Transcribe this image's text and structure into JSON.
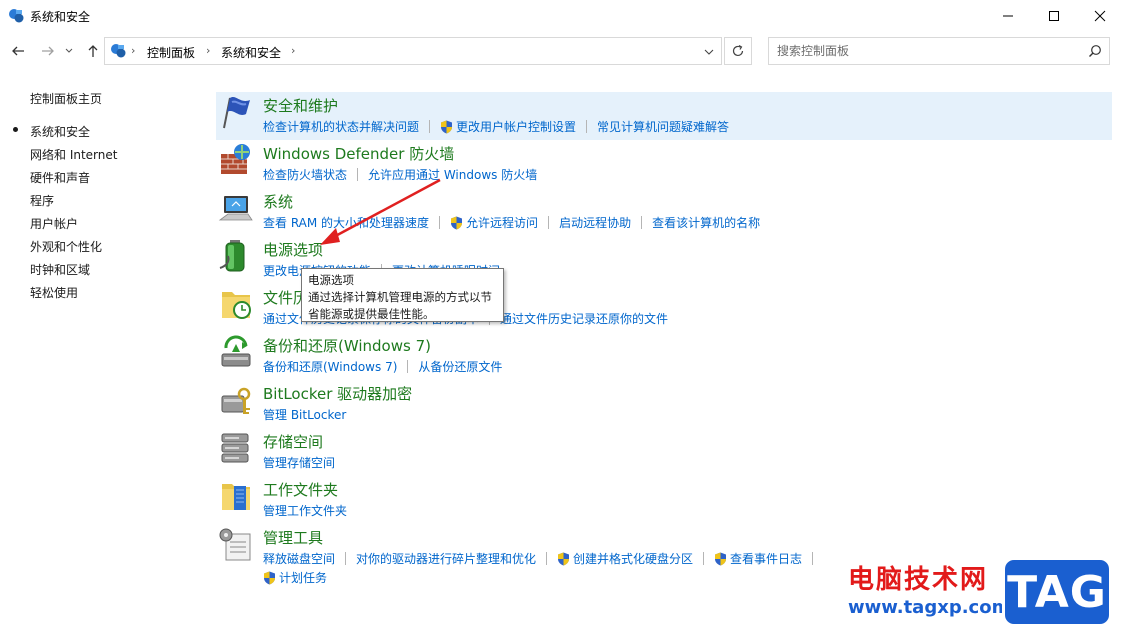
{
  "window": {
    "title": "系统和安全"
  },
  "address": {
    "crumbs": [
      "控制面板",
      "系统和安全"
    ]
  },
  "search": {
    "placeholder": "搜索控制面板"
  },
  "sidebar": {
    "items": [
      {
        "label": "控制面板主页",
        "selected": false
      },
      {
        "label": "系统和安全",
        "selected": true
      },
      {
        "label": "网络和 Internet",
        "selected": false
      },
      {
        "label": "硬件和声音",
        "selected": false
      },
      {
        "label": "程序",
        "selected": false
      },
      {
        "label": "用户帐户",
        "selected": false
      },
      {
        "label": "外观和个性化",
        "selected": false
      },
      {
        "label": "时钟和区域",
        "selected": false
      },
      {
        "label": "轻松使用",
        "selected": false
      }
    ]
  },
  "categories": [
    {
      "title": "安全和维护",
      "icon": "flag-icon",
      "links": [
        {
          "label": "检查计算机的状态并解决问题",
          "shield": false
        },
        {
          "label": "更改用户帐户控制设置",
          "shield": true
        },
        {
          "label": "常见计算机问题疑难解答",
          "shield": false
        }
      ]
    },
    {
      "title": "Windows Defender 防火墙",
      "icon": "firewall-icon",
      "links": [
        {
          "label": "检查防火墙状态",
          "shield": false
        },
        {
          "label": "允许应用通过 Windows 防火墙",
          "shield": false
        }
      ]
    },
    {
      "title": "系统",
      "icon": "computer-icon",
      "links": [
        {
          "label": "查看 RAM 的大小和处理器速度",
          "shield": false
        },
        {
          "label": "允许远程访问",
          "shield": true
        },
        {
          "label": "启动远程协助",
          "shield": false
        },
        {
          "label": "查看该计算机的名称",
          "shield": false
        }
      ]
    },
    {
      "title": "电源选项",
      "icon": "battery-icon",
      "links": [
        {
          "label": "更改电源按钮的功能",
          "shield": false
        },
        {
          "label": "更改计算机睡眠时间",
          "shield": false
        }
      ]
    },
    {
      "title": "文件历史记录",
      "icon": "file-history-icon",
      "links": [
        {
          "label": "通过文件历史记录保存你的文件备份副本",
          "shield": false
        },
        {
          "label": "通过文件历史记录还原你的文件",
          "shield": false
        }
      ]
    },
    {
      "title": "备份和还原(Windows 7)",
      "icon": "backup-icon",
      "links": [
        {
          "label": "备份和还原(Windows 7)",
          "shield": false
        },
        {
          "label": "从备份还原文件",
          "shield": false
        }
      ]
    },
    {
      "title": "BitLocker 驱动器加密",
      "icon": "bitlocker-icon",
      "links": [
        {
          "label": "管理 BitLocker",
          "shield": false
        }
      ]
    },
    {
      "title": "存储空间",
      "icon": "storage-icon",
      "links": [
        {
          "label": "管理存储空间",
          "shield": false
        }
      ]
    },
    {
      "title": "工作文件夹",
      "icon": "work-folders-icon",
      "links": [
        {
          "label": "管理工作文件夹",
          "shield": false
        }
      ]
    },
    {
      "title": "管理工具",
      "icon": "admin-tools-icon",
      "links": [
        {
          "label": "释放磁盘空间",
          "shield": false
        },
        {
          "label": "对你的驱动器进行碎片整理和优化",
          "shield": false
        },
        {
          "label": "创建并格式化硬盘分区",
          "shield": true
        },
        {
          "label": "查看事件日志",
          "shield": true
        }
      ],
      "links2": [
        {
          "label": "计划任务",
          "shield": true
        }
      ]
    }
  ],
  "tooltip": {
    "title": "电源选项",
    "line1": "通过选择计算机管理电源的方式以节",
    "line2": "省能源或提供最佳性能。"
  },
  "watermark": {
    "text": "电脑技术网",
    "url": "www.tagxp.com",
    "badge": "TAG"
  },
  "colors": {
    "category_title": "#1e7a1e",
    "link": "#0066cc",
    "highlight": "#e5f1fb",
    "arrow": "#e02020"
  }
}
